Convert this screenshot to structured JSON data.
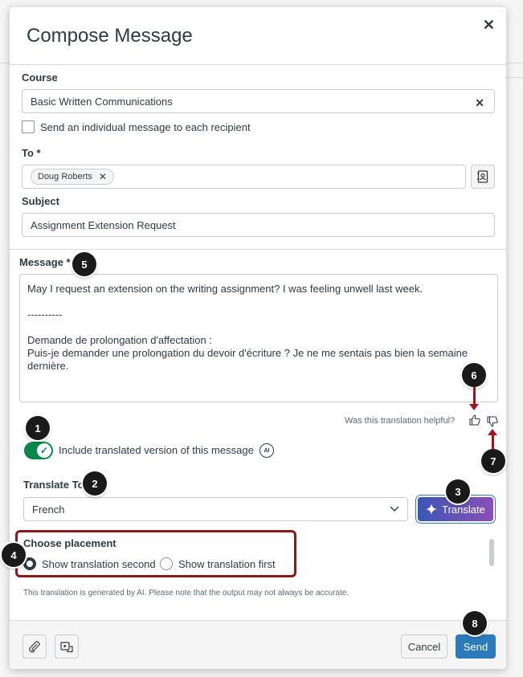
{
  "modal": {
    "title": "Compose Message",
    "close_icon": "close-icon"
  },
  "course": {
    "label": "Course",
    "value": "Basic Written Communications",
    "clear_icon": "close-icon"
  },
  "individual_message": {
    "label": "Send an individual message to each recipient",
    "checked": false
  },
  "to": {
    "label": "To *",
    "recipients": [
      {
        "name": "Doug Roberts",
        "remove_icon": "close-icon"
      }
    ],
    "address_book_icon": "address-book-icon"
  },
  "subject": {
    "label": "Subject",
    "value": "Assignment Extension Request"
  },
  "message": {
    "label": "Message *",
    "lines": [
      "May I request an extension on the writing assignment? I was feeling unwell last week.",
      "----------",
      "Demande de prolongation d'affectation :",
      "Puis-je demander une prolongation du devoir d'écriture ? Je ne me sentais pas bien la semaine dernière."
    ]
  },
  "feedback": {
    "question": "Was this translation helpful?",
    "thumbs_up_icon": "thumbs-up-icon",
    "thumbs_down_icon": "thumbs-down-icon"
  },
  "include_translation": {
    "label": "Include translated version of this message",
    "enabled": true,
    "ai_badge": "AI"
  },
  "translate_to": {
    "label": "Translate To",
    "selected": "French",
    "button_label": "Translate",
    "sparkle_icon": "sparkle-icon"
  },
  "placement": {
    "label": "Choose placement",
    "options": [
      {
        "label": "Show translation second",
        "selected": true
      },
      {
        "label": "Show translation first",
        "selected": false
      }
    ]
  },
  "disclaimer": "This translation is generated by AI. Please note that the output may not always be accurate.",
  "footer": {
    "attach_icon": "paperclip-icon",
    "media_icon": "media-icon",
    "cancel_label": "Cancel",
    "send_label": "Send"
  },
  "callouts": [
    "1",
    "2",
    "3",
    "4",
    "5",
    "6",
    "7",
    "8"
  ],
  "colors": {
    "toggle_on": "#0b874b",
    "send_button": "#2b7abc",
    "callout_outline": "#8b1a1a",
    "translate_gradient_start": "#3a57b6",
    "translate_gradient_end": "#8a4fb7"
  }
}
